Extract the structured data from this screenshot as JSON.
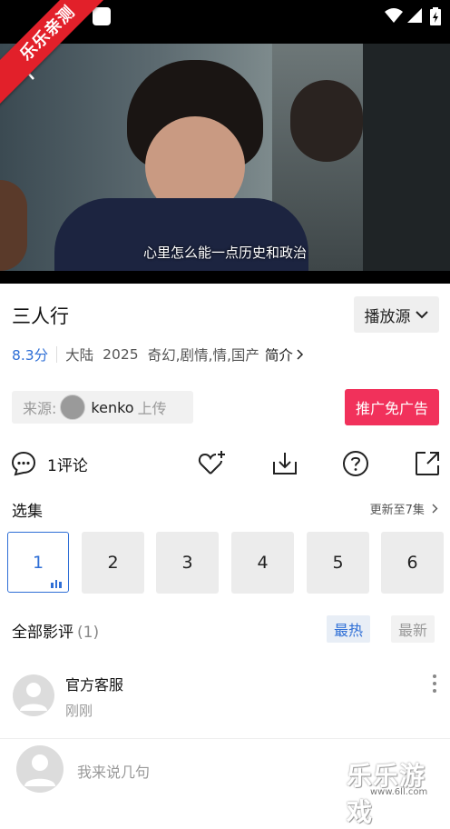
{
  "banner": {
    "label": "乐乐亲测"
  },
  "video": {
    "subtitle": "心里怎么能一点历史和政治"
  },
  "title": "三人行",
  "source_button": {
    "label": "播放源"
  },
  "meta": {
    "score": "8.3分",
    "region": "大陆",
    "year": "2025",
    "genres": "奇幻,剧情,情,国产",
    "intro": "简介"
  },
  "uploader": {
    "prefix": "来源:",
    "name": "kenko",
    "suffix": "上传"
  },
  "ad_free": {
    "label": "推广免广告"
  },
  "actions": {
    "comment_label": "1评论"
  },
  "episodes": {
    "title": "选集",
    "updated": "更新至7集",
    "items": [
      "1",
      "2",
      "3",
      "4",
      "5",
      "6"
    ],
    "active_index": 0
  },
  "comments": {
    "title": "全部影评",
    "count": "(1)",
    "sort_hot": "最热",
    "sort_new": "最新",
    "items": [
      {
        "name": "官方客服",
        "time": "刚刚"
      }
    ]
  },
  "input": {
    "placeholder": "我来说几句"
  },
  "watermark": {
    "text": "乐乐游戏",
    "url": "www.6ll.com"
  },
  "colors": {
    "accent": "#2f6fd6",
    "promo": "#f1315b",
    "banner": "#e2202a"
  }
}
